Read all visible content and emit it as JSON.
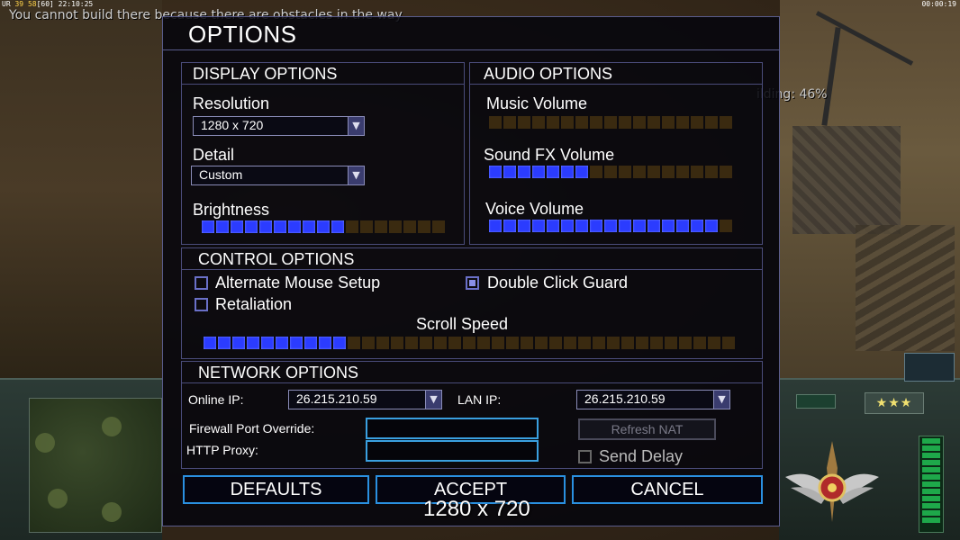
{
  "hud": {
    "stats_prefix": "UR",
    "stats_a": "39",
    "stats_b": "58",
    "stats_c": "[60]",
    "time": "22:10:25",
    "game_clock": "00:00:19",
    "notice": "You cannot build there because there are obstacles in the way",
    "building_status": "ilding: 46%",
    "rank_stars": "★★★"
  },
  "dialog": {
    "title": "OPTIONS",
    "display": {
      "heading": "DISPLAY OPTIONS",
      "resolution_label": "Resolution",
      "resolution_value": "1280 x 720",
      "detail_label": "Detail",
      "detail_value": "Custom",
      "brightness_label": "Brightness",
      "brightness_level": 10,
      "brightness_max": 17
    },
    "audio": {
      "heading": "AUDIO OPTIONS",
      "music_label": "Music Volume",
      "music_level": 0,
      "music_max": 17,
      "sfx_label": "Sound FX Volume",
      "sfx_level": 7,
      "sfx_max": 17,
      "voice_label": "Voice Volume",
      "voice_level": 16,
      "voice_max": 17
    },
    "control": {
      "heading": "CONTROL OPTIONS",
      "alt_mouse_label": "Alternate Mouse Setup",
      "alt_mouse_checked": false,
      "double_click_label": "Double Click Guard",
      "double_click_checked": true,
      "retaliation_label": "Retaliation",
      "retaliation_checked": false,
      "scroll_label": "Scroll Speed",
      "scroll_level": 10,
      "scroll_max": 37
    },
    "network": {
      "heading": "NETWORK OPTIONS",
      "online_ip_label": "Online IP:",
      "online_ip_value": "26.215.210.59",
      "lan_ip_label": "LAN IP:",
      "lan_ip_value": "26.215.210.59",
      "firewall_label": "Firewall Port Override:",
      "firewall_value": "",
      "proxy_label": "HTTP Proxy:",
      "proxy_value": "",
      "refresh_nat_label": "Refresh NAT",
      "send_delay_label": "Send Delay",
      "send_delay_checked": false
    },
    "buttons": {
      "defaults": "DEFAULTS",
      "accept": "ACCEPT",
      "cancel": "CANCEL"
    }
  },
  "overlay_resolution": "1280 x 720",
  "colors": {
    "slider_on": "#2b3cff",
    "slider_off": "#3a2a10",
    "button_border": "#2a90e0",
    "panel_border": "#4a4c7a"
  }
}
